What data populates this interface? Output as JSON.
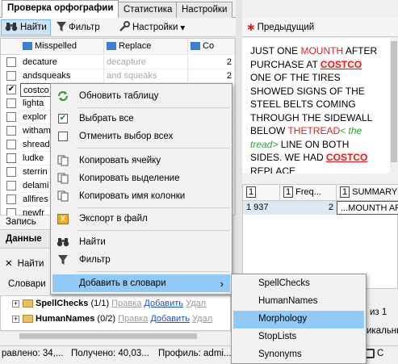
{
  "tabs": [
    "Проверка орфографии",
    "Статистика",
    "Настройки"
  ],
  "toolbar": {
    "find": "Найти",
    "filter": "Фильтр",
    "settings": "Настройки",
    "settings_arrow": "▾"
  },
  "grid": {
    "headers": {
      "misspelled": "Misspelled",
      "replace": "Replace",
      "count": "Co"
    },
    "rows": [
      {
        "checked": false,
        "misspelled": "decature",
        "replace": "decapture",
        "count": "2"
      },
      {
        "checked": false,
        "misspelled": "andsqueaks",
        "replace": "and squeaks",
        "count": "2"
      },
      {
        "checked": true,
        "misspelled": "costco",
        "replace": "",
        "count": ""
      },
      {
        "checked": false,
        "misspelled": "lighta",
        "replace": "",
        "count": ""
      },
      {
        "checked": false,
        "misspelled": "explor",
        "replace": "",
        "count": ""
      },
      {
        "checked": false,
        "misspelled": "witham",
        "replace": "",
        "count": ""
      },
      {
        "checked": false,
        "misspelled": "shread",
        "replace": "",
        "count": ""
      },
      {
        "checked": false,
        "misspelled": "ludke",
        "replace": "",
        "count": ""
      },
      {
        "checked": false,
        "misspelled": "sterrin",
        "replace": "",
        "count": ""
      },
      {
        "checked": false,
        "misspelled": "delami",
        "replace": "",
        "count": ""
      },
      {
        "checked": false,
        "misspelled": "allfires",
        "replace": "",
        "count": ""
      },
      {
        "checked": false,
        "misspelled": "newfr",
        "replace": "",
        "count": ""
      }
    ]
  },
  "left_bottom": {
    "record_label": "Запись",
    "data_tab": "Данные",
    "find_label": "Найти",
    "dictionaries_label": "Словари",
    "dicts": [
      {
        "name": "SpellChecks",
        "count": "(1/1)",
        "edit": "Правка",
        "add": "Добавить",
        "remove": "Удал"
      },
      {
        "name": "HumanNames",
        "count": "(0/2)",
        "edit": "Правка",
        "add": "Добавить",
        "remove": "Удал"
      }
    ]
  },
  "right": {
    "prev_button": "Предыдущий",
    "text": {
      "p1": "JUST ONE ",
      "p2": "MOUNTH",
      "p3": " AFTER PURCHASE AT ",
      "p4": "COSTCO",
      "p5": " ONE OF THE TIRES SHOWED SIGNS OF THE STEEL BELTS COMING THROUGH THE SIDEWALL BELOW ",
      "p6": "THETREAD",
      "p7": "< the tread>",
      "p8": " LINE ON BOTH SIDES. WE HAD ",
      "p9": "COSTCO",
      "p10": " REPLACE"
    },
    "grid_headers": [
      "1",
      "Freq...",
      "1",
      "SUMMARY"
    ],
    "grid_row": {
      "c1": "1 937",
      "c2": "2",
      "c3": "...MOUNTH AF"
    },
    "pager": "из 1",
    "partial_word": "икальны"
  },
  "status": {
    "s1": "равлено: 34,...",
    "s2": "Получено: 40,03...",
    "s3": "Профиль: admi...",
    "s4": "С"
  },
  "context_menu": {
    "items": [
      "Обновить таблицу",
      "Выбрать все",
      "Отменить выбор всех",
      "Копировать ячейку",
      "Копировать выделение",
      "Копировать имя колонки",
      "Экспорт в файл",
      "Найти",
      "Фильтр",
      "Добавить в словари"
    ],
    "submenu_arrow": "›",
    "submenu": [
      "SpellChecks",
      "HumanNames",
      "Morphology",
      "StopLists",
      "Synonyms"
    ]
  },
  "colors": {
    "highlight": "#91c9f7",
    "error_red": "#e02020",
    "suggestion_green": "#2aa52a"
  }
}
